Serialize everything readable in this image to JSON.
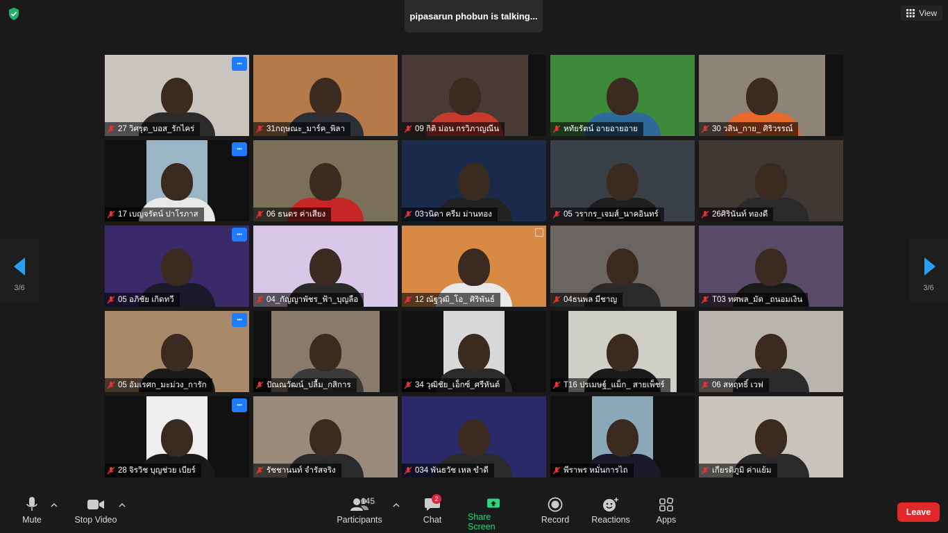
{
  "talking_banner": "pipasarun phobun is talking...",
  "view_button": "View",
  "pagination": {
    "left": "3/6",
    "right": "3/6"
  },
  "tiles": [
    {
      "name": "27 วิศรุต_บอส_รักไคร่",
      "bg": "#c9c4bd",
      "shirt": "#2b2b2b",
      "more": true,
      "v": "full"
    },
    {
      "name": "31กฤษณะ_มาร์ค_พิลา",
      "bg": "#b57a4a",
      "shirt": "#2a2f38",
      "more": false,
      "v": "full"
    },
    {
      "name": "09 กิติ ม่อน กรวิภาญณีน",
      "bg": "#4a3a35",
      "shirt": "#c83a2c",
      "more": false,
      "v": "wide"
    },
    {
      "name": "หทัยรัตน์ อายอายอาย",
      "bg": "#3c8a3a",
      "shirt": "#2f6a9c",
      "more": false,
      "v": "full"
    },
    {
      "name": "30 วสิน_กาย_ ศิริวรรณ์",
      "bg": "#8d8377",
      "shirt": "#e86a2a",
      "more": false,
      "v": "wide"
    },
    {
      "name": "17 เบญจรัตน์ ปาโรภาส",
      "bg": "#9ab5c4",
      "shirt": "#e8e8e8",
      "more": true,
      "v": "narrow"
    },
    {
      "name": "06 ธนดร ค่าเสียง",
      "bg": "#7a6f58",
      "shirt": "#c52626",
      "more": false,
      "v": "full"
    },
    {
      "name": "03วนิดา ครีม ม่านทอง",
      "bg": "#1a2a4a",
      "shirt": "#222222",
      "more": false,
      "v": "full"
    },
    {
      "name": "05 วรากร_เจมส์_นาคอินทร์",
      "bg": "#3a4048",
      "shirt": "#1f1f1f",
      "more": false,
      "v": "full"
    },
    {
      "name": "26ศิรินันท์ ทองดี",
      "bg": "#3f3833",
      "shirt": "#2a2a2a",
      "more": false,
      "v": "full"
    },
    {
      "name": "05 อภิชัย เกิดทวี",
      "bg": "#3a2a6a",
      "shirt": "#1a1a2a",
      "more": true,
      "v": "full"
    },
    {
      "name": "04_กัญญาพัชร_ฟ้า_บุญลือ",
      "bg": "#d7c6e8",
      "shirt": "#2a2a2a",
      "more": false,
      "v": "full"
    },
    {
      "name": "12 ณัฐวุฒิ_โอ_ ศิริพันธ์",
      "bg": "#d88a45",
      "shirt": "#e8e8e8",
      "more": false,
      "v": "full"
    },
    {
      "name": "04ธนพล มีชาญ",
      "bg": "#6a6560",
      "shirt": "#2a2a2a",
      "more": false,
      "v": "full"
    },
    {
      "name": "T03 ทศพล_มัด _ถนอมเงิน",
      "bg": "#5a4a6a",
      "shirt": "#1a1a1a",
      "more": false,
      "v": "full"
    },
    {
      "name": "05 อัมเรศก_มะม่วง_การัก",
      "bg": "#a88a6a",
      "shirt": "#1a1a1a",
      "more": true,
      "v": "full"
    },
    {
      "name": "ปัณณวัฒน์_ปลื้ม_กสิการ",
      "bg": "#8a7a6a",
      "shirt": "#3a3a3a",
      "more": false,
      "v": "mid"
    },
    {
      "name": "34 วุฒิชัย_เอ็กซ์_ศรีหันต์",
      "bg": "#d8d8da",
      "shirt": "#2a2a2a",
      "more": false,
      "v": "narrow"
    },
    {
      "name": "T16 ปรเมษฐ์_แม็ก_ สายเพ็ชร์",
      "bg": "#cfcfc8",
      "shirt": "#1a1a1a",
      "more": false,
      "v": "mid"
    },
    {
      "name": "06 สหฤทธิ์ เวฟ",
      "bg": "#b8b4ae",
      "shirt": "#2a2a2a",
      "more": false,
      "v": "full"
    },
    {
      "name": "28 จิรวิช บุญช่วย เบียร์",
      "bg": "#eeeeee",
      "shirt": "#1a1a1a",
      "more": true,
      "v": "narrow"
    },
    {
      "name": "รัชชานนท์ จำรัสจริง",
      "bg": "#9a8a7a",
      "shirt": "#2a2a2a",
      "more": false,
      "v": "full"
    },
    {
      "name": "034 พันธวัช เหล ขำดี",
      "bg": "#2a2a6a",
      "shirt": "#2a2a2a",
      "more": false,
      "v": "full"
    },
    {
      "name": "พีราพร หมั่นการไถ",
      "bg": "#8aa8b8",
      "shirt": "#1a1a2a",
      "more": false,
      "v": "narrow"
    },
    {
      "name": "เกียรติภูมิ ค่าแย้ม",
      "bg": "#c8c4bc",
      "shirt": "#2a2a2a",
      "more": false,
      "v": "full"
    }
  ],
  "toolbar": {
    "mute": "Mute",
    "stop_video": "Stop Video",
    "participants": "Participants",
    "participants_count": "145",
    "chat": "Chat",
    "chat_badge": "2",
    "share_screen": "Share Screen",
    "record": "Record",
    "reactions": "Reactions",
    "apps": "Apps",
    "leave": "Leave"
  },
  "colors": {
    "share_green": "#2dd67a",
    "leave_red": "#e02828",
    "accent_blue": "#1f7bff",
    "nav_blue": "#2a9df4"
  }
}
